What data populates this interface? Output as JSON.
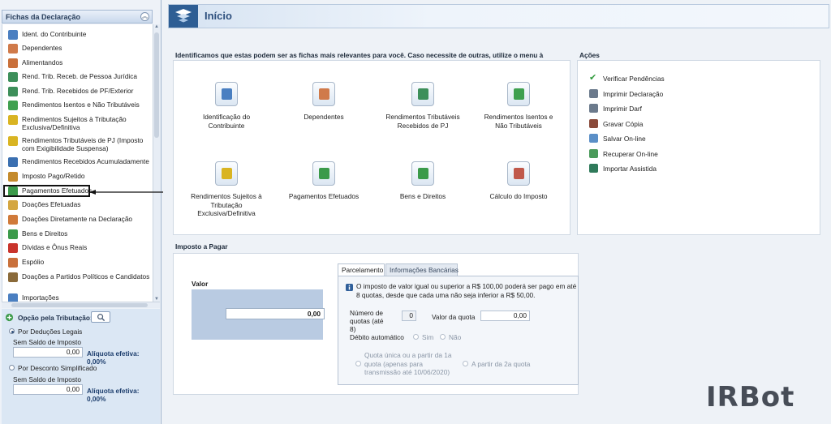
{
  "sidebar": {
    "title": "Fichas da Declaração",
    "collapse_icon": "chevron-double-up-icon",
    "items": [
      {
        "label": "Ident. do Contribuinte",
        "icon": "person-icon",
        "color": "#4a7fc1"
      },
      {
        "label": "Dependentes",
        "icon": "people-icon",
        "color": "#d07a4a"
      },
      {
        "label": "Alimentandos",
        "icon": "family-icon",
        "color": "#c9703b"
      },
      {
        "label": "Rend. Trib. Receb. de Pessoa Jurídica",
        "icon": "money-transfer-icon",
        "color": "#3d8f5a"
      },
      {
        "label": "Rend. Trib. Recebidos de PF/Exterior",
        "icon": "money-transfer-icon",
        "color": "#3d8f5a"
      },
      {
        "label": "Rendimentos Isentos e Não Tributáveis",
        "icon": "check-doc-icon",
        "color": "#3fa04f"
      },
      {
        "label": "Rendimentos Sujeitos à Tributação Exclusiva/Definitiva",
        "icon": "warning-doc-icon",
        "color": "#d9b422"
      },
      {
        "label": "Rendimentos Tributáveis de PJ (Imposto com Exigibilidade Suspensa)",
        "icon": "warning-money-icon",
        "color": "#d9b422"
      },
      {
        "label": "Rendimentos Recebidos Acumuladamente",
        "icon": "refresh-icon",
        "color": "#3a6fb0"
      },
      {
        "label": "Imposto Pago/Retido",
        "icon": "coin-icon",
        "color": "#c48a2c"
      },
      {
        "label": "Pagamentos Efetuados",
        "icon": "card-icon",
        "color": "#3b9a4a"
      },
      {
        "label": "Doações Efetuadas",
        "icon": "gift-doc-icon",
        "color": "#d4a640"
      },
      {
        "label": "Doações Diretamente na Declaração",
        "icon": "gift-icon",
        "color": "#d07a3a"
      },
      {
        "label": "Bens e Direitos",
        "icon": "money-bag-icon",
        "color": "#3b9a4a"
      },
      {
        "label": "Dívidas e Ônus Reais",
        "icon": "down-arrow-icon",
        "color": "#c9342c"
      },
      {
        "label": "Espólio",
        "icon": "house-icon",
        "color": "#c9703b"
      },
      {
        "label": "Doações a Partidos Políticos e Candidatos",
        "icon": "handshake-icon",
        "color": "#8a6a3a"
      },
      {
        "label": "Importações",
        "icon": "import-icon",
        "color": "#4a7fc1"
      }
    ]
  },
  "tributacao": {
    "title": "Opção pela Tributação:",
    "search_icon": "search-icon",
    "options": [
      {
        "label": "Por Deduções Legais",
        "sub": "Sem Saldo de Imposto",
        "value": "0,00",
        "aliquota": "Alíquota efetiva: 0,00%",
        "selected": true
      },
      {
        "label": "Por Desconto Simplificado",
        "sub": "Sem Saldo de Imposto",
        "value": "0,00",
        "aliquota": "Alíquota efetiva: 0,00%",
        "selected": false
      }
    ]
  },
  "header": {
    "title": "Início",
    "logo_icon": "receita-logo-icon"
  },
  "fichas_panel": {
    "heading": "Identificamos que estas podem ser as fichas mais relevantes para você. Caso necessite de outras, utilize o menu à esquerda.",
    "items": [
      {
        "label": "Identificação do Contribuinte",
        "icon": "person-icon"
      },
      {
        "label": "Dependentes",
        "icon": "people-icon"
      },
      {
        "label": "Rendimentos Tributáveis Recebidos de PJ",
        "icon": "money-transfer-icon"
      },
      {
        "label": "Rendimentos Isentos e Não Tributáveis",
        "icon": "check-doc-icon"
      },
      {
        "label": "Rendimentos Sujeitos à Tributação Exclusiva/Definitiva",
        "icon": "warning-doc-icon"
      },
      {
        "label": "Pagamentos Efetuados",
        "icon": "card-icon"
      },
      {
        "label": "Bens e Direitos",
        "icon": "money-bag-icon"
      },
      {
        "label": "Cálculo do Imposto",
        "icon": "percent-icon"
      }
    ]
  },
  "acoes": {
    "heading": "Ações",
    "items": [
      {
        "label": "Verificar Pendências",
        "icon": "checkmark-icon",
        "color": "#2f9a3c"
      },
      {
        "label": "Imprimir Declaração",
        "icon": "printer-icon",
        "color": "#6b7a8c"
      },
      {
        "label": "Imprimir Darf",
        "icon": "printer-icon",
        "color": "#6b7a8c"
      },
      {
        "label": "Gravar Cópia",
        "icon": "save-icon",
        "color": "#8a4a3a"
      },
      {
        "label": "Salvar On-line",
        "icon": "cloud-upload-icon",
        "color": "#5b8fc7"
      },
      {
        "label": "Recuperar On-line",
        "icon": "cloud-download-icon",
        "color": "#4a9a5a"
      },
      {
        "label": "Importar Assistida",
        "icon": "globe-icon",
        "color": "#2f7a5a"
      }
    ]
  },
  "imposto": {
    "heading": "Imposto a Pagar",
    "valor_label": "Valor",
    "valor": "0,00",
    "tabs": [
      "Parcelamento",
      "Informações Bancárias"
    ],
    "info_icon": "info-icon",
    "info_text": "O imposto de valor igual ou superior a R$ 100,00 poderá ser pago em até 8 quotas, desde que cada uma não seja inferior a R$ 50,00.",
    "num_quotas_label": "Número de quotas (até 8)",
    "num_quotas": "0",
    "valor_quota_label": "Valor da quota",
    "valor_quota": "0,00",
    "debito_label": "Débito automático",
    "sim": "Sim",
    "nao": "Não",
    "quota_unica": "Quota única ou a partir da 1a quota (apenas para transmissão até 10/06/2020)",
    "segunda_quota": "A partir da 2a quota"
  },
  "watermark": "IRBot"
}
